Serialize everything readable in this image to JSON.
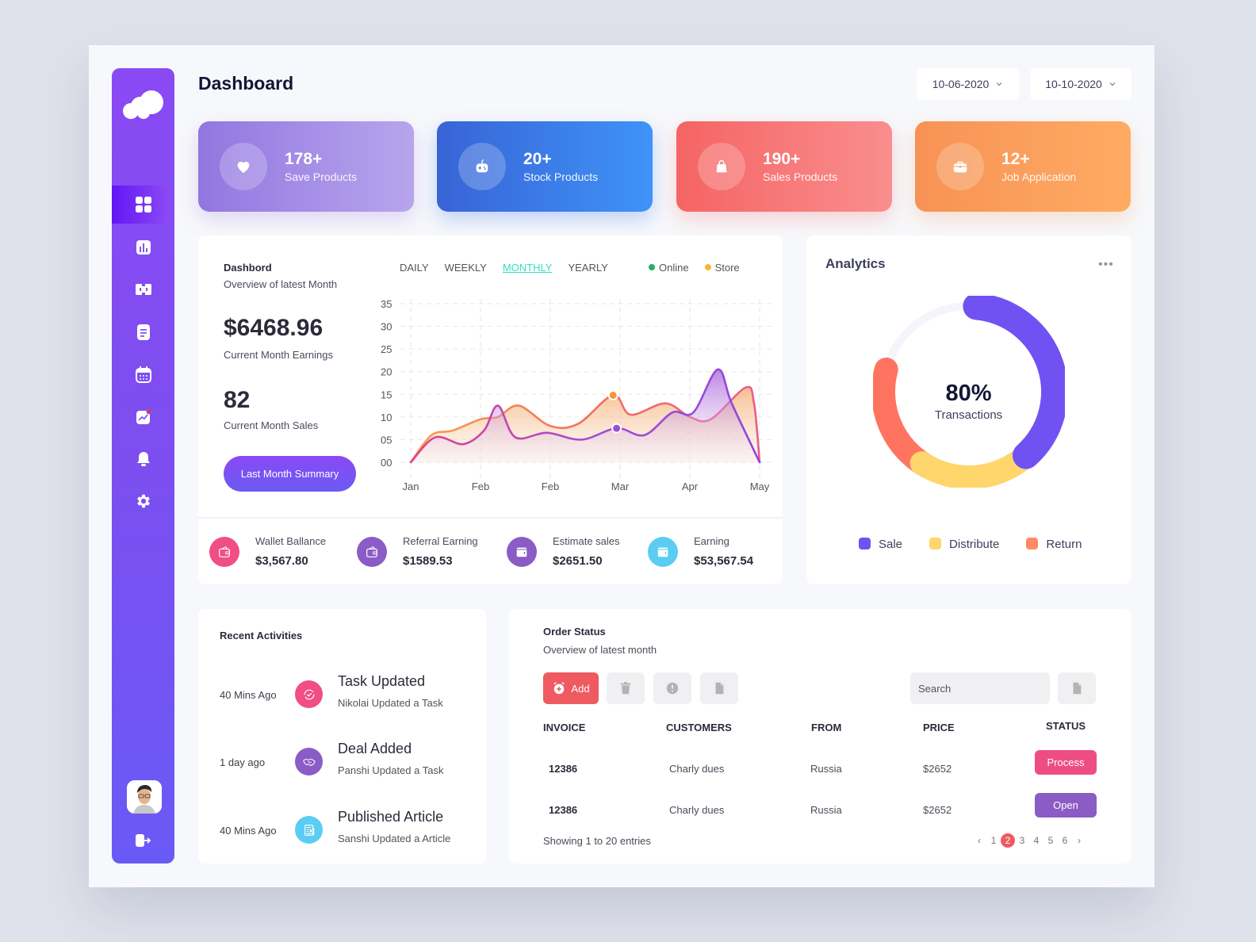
{
  "header": {
    "title": "Dashboard",
    "date_from": "10-06-2020",
    "date_to": "10-10-2020"
  },
  "sidebar": {
    "items": [
      {
        "name": "dashboard",
        "icon": "grid-icon",
        "active": true
      },
      {
        "name": "analytics",
        "icon": "bar-chart-icon",
        "active": false
      },
      {
        "name": "apps",
        "icon": "apps-icon",
        "active": false
      },
      {
        "name": "documents",
        "icon": "document-icon",
        "active": false
      },
      {
        "name": "calendar",
        "icon": "calendar-icon",
        "active": false
      },
      {
        "name": "trends",
        "icon": "trend-chart-icon",
        "active": false,
        "badge": true
      },
      {
        "name": "notifications",
        "icon": "bell-icon",
        "active": false
      },
      {
        "name": "settings",
        "icon": "gear-icon",
        "active": false
      }
    ]
  },
  "stat_cards": [
    {
      "value": "178+",
      "label": "Save Products",
      "icon": "heart-icon"
    },
    {
      "value": "20+",
      "label": "Stock Products",
      "icon": "gamepad-icon"
    },
    {
      "value": "190+",
      "label": "Sales Products",
      "icon": "shopping-bag-icon"
    },
    {
      "value": "12+",
      "label": "Job Application",
      "icon": "briefcase-icon"
    }
  ],
  "overview": {
    "title": "Dashbord",
    "subtitle": "Overview of latest Month",
    "earnings": "$6468.96",
    "earnings_label": "Current Month Earnings",
    "sales": "82",
    "sales_label": "Current Month Sales",
    "summary_button": "Last Month Summary",
    "tabs": [
      "DAILY",
      "WEEKLY",
      "MONTHLY",
      "YEARLY"
    ],
    "active_tab": "MONTHLY",
    "legend": [
      {
        "label": "Online",
        "color": "#27ae60"
      },
      {
        "label": "Store",
        "color": "#f7b731"
      }
    ]
  },
  "chart_data": {
    "type": "area",
    "title": "Dashbord",
    "subtitle": "Overview of latest Month",
    "x_tick_labels": [
      "Jan",
      "Feb",
      "Feb",
      "Mar",
      "Apr",
      "May"
    ],
    "y_tick_labels": [
      "00",
      "05",
      "10",
      "15",
      "20",
      "25",
      "30",
      "35"
    ],
    "ylim": [
      0,
      35
    ],
    "xlim": [
      0,
      5
    ],
    "grid": true,
    "legend_position": "top-right",
    "series": [
      {
        "name": "Store",
        "color": "#f36f5f",
        "x": [
          0,
          0.3,
          0.6,
          1.0,
          1.25,
          1.55,
          2.0,
          2.4,
          2.9,
          3.15,
          3.65,
          4.0,
          4.3,
          4.8,
          4.92,
          5.0
        ],
        "y": [
          0,
          6,
          7,
          9.5,
          10,
          12.5,
          8,
          8.5,
          14.8,
          10.5,
          13,
          10,
          9.5,
          16.5,
          13,
          0
        ],
        "highlight": {
          "x": 2.9,
          "y": 14.8
        }
      },
      {
        "name": "Online",
        "color": "#9b4fd6",
        "x": [
          0,
          0.35,
          0.75,
          1.05,
          1.25,
          1.5,
          1.95,
          2.45,
          2.95,
          3.35,
          3.75,
          4.05,
          4.4,
          4.6,
          5.0
        ],
        "y": [
          0,
          5.5,
          4,
          7,
          12.5,
          5.5,
          6.5,
          5,
          7.5,
          6,
          11,
          11,
          20.5,
          13,
          0
        ],
        "highlight": {
          "x": 2.95,
          "y": 7.5
        }
      }
    ]
  },
  "mini_stats": [
    {
      "label": "Wallet Ballance",
      "value": "$3,567.80",
      "color": "#f04e85",
      "icon": "wallet-icon"
    },
    {
      "label": "Referral Earning",
      "value": "$1589.53",
      "color": "#8b5cc5",
      "icon": "wallet-icon"
    },
    {
      "label": "Estimate sales",
      "value": "$2651.50",
      "color": "#8b5cc5",
      "icon": "card-wallet-icon"
    },
    {
      "label": "Earning",
      "value": "$53,567.54",
      "color": "#5bcdf2",
      "icon": "card-wallet-icon"
    }
  ],
  "analytics": {
    "title": "Analytics",
    "center_value": "80%",
    "center_label": "Transactions",
    "segments": [
      {
        "label": "Sale",
        "percent": 37,
        "color": "#7052f2"
      },
      {
        "label": "Distribute",
        "percent": 22,
        "color": "#ffd66b"
      },
      {
        "label": "Return",
        "percent": 21,
        "color": "#ff7461"
      }
    ]
  },
  "activities": {
    "title": "Recent Activities",
    "items": [
      {
        "time": "40 Mins Ago",
        "title": "Task Updated",
        "desc": "Nikolai Updated a Task",
        "color": "#f04e85",
        "icon": "task-check-icon"
      },
      {
        "time": "1 day ago",
        "title": "Deal Added",
        "desc": "Panshi Updated a Task",
        "color": "#8b5cc5",
        "icon": "handshake-icon"
      },
      {
        "time": "40 Mins Ago",
        "title": "Published Article",
        "desc": "Sanshi Updated a Article",
        "color": "#5bcdf2",
        "icon": "newspaper-icon"
      }
    ]
  },
  "orders": {
    "title": "Order Status",
    "subtitle": "Overview of latest month",
    "add_label": "Add",
    "search_placeholder": "Search",
    "columns": [
      "INVOICE",
      "CUSTOMERS",
      "FROM",
      "PRICE",
      "STATUS"
    ],
    "rows": [
      {
        "invoice": "12386",
        "customer": "Charly dues",
        "from": "Russia",
        "price": "$2652",
        "status": "Process",
        "status_color": "#ee4d84"
      },
      {
        "invoice": "12386",
        "customer": "Charly dues",
        "from": "Russia",
        "price": "$2652",
        "status": "Open",
        "status_color": "#8b5cc5"
      }
    ],
    "showing": "Showing 1 to 20 entries",
    "pages": [
      "1",
      "2",
      "3",
      "4",
      "5",
      "6"
    ],
    "current_page": "2"
  }
}
